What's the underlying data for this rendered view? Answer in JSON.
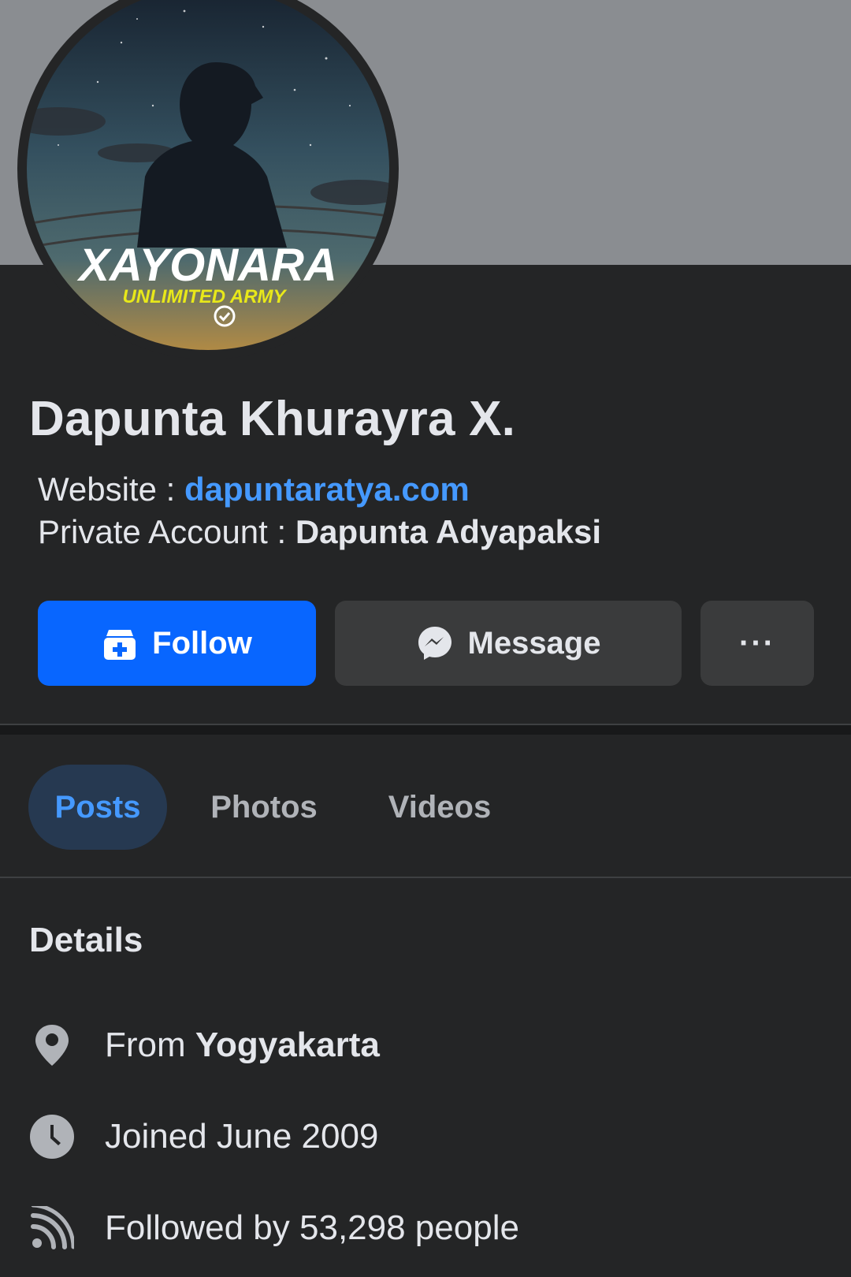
{
  "profile": {
    "name": "Dapunta Khurayra X.",
    "avatar_brand_text": "XAYONARA",
    "avatar_brand_subtext": "UNLIMITED ARMY"
  },
  "bio": {
    "website_label": "Website : ",
    "website_value": "dapuntaratya.com",
    "private_label": "Private Account : ",
    "private_value": "Dapunta Adyapaksi"
  },
  "actions": {
    "follow_label": "Follow",
    "message_label": "Message",
    "more_label": "···"
  },
  "tabs": [
    {
      "label": "Posts",
      "active": true
    },
    {
      "label": "Photos",
      "active": false
    },
    {
      "label": "Videos",
      "active": false
    }
  ],
  "details": {
    "title": "Details",
    "from_prefix": "From ",
    "from_value": "Yogyakarta",
    "joined": "Joined June 2009",
    "followed": "Followed by 53,298 people"
  },
  "icons": {
    "follow": "follow-add-icon",
    "message": "messenger-icon",
    "more": "more-dots-icon",
    "location": "location-pin-icon",
    "clock": "clock-icon",
    "rss": "rss-feed-icon",
    "verified": "verified-check-icon"
  },
  "colors": {
    "background": "#242526",
    "cover": "#8a8d91",
    "accent": "#0866ff",
    "link": "#4599ff",
    "active_tab_bg": "#263951",
    "button_secondary": "#3a3b3c",
    "text_primary": "#e4e6eb",
    "text_secondary": "#b0b3b8"
  }
}
